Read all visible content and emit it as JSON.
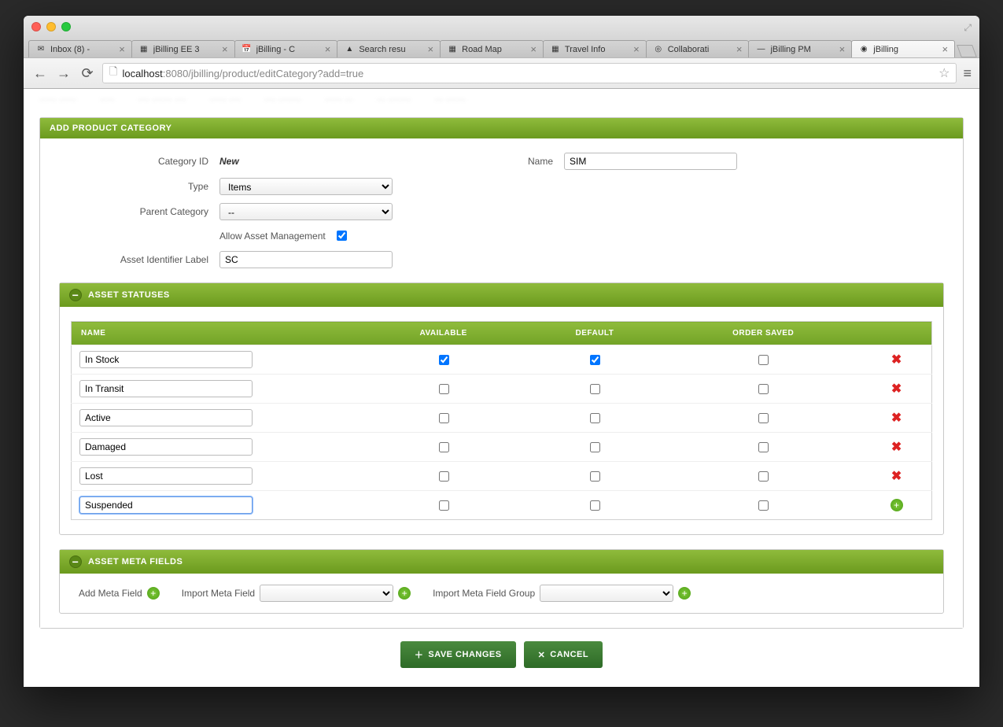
{
  "browser": {
    "url_host": "localhost",
    "url_path": ":8080/jbilling/product/editCategory?add=true",
    "tabs": [
      {
        "title": "Inbox (8) -",
        "icon": "✉"
      },
      {
        "title": "jBilling EE 3",
        "icon": "▦"
      },
      {
        "title": "jBilling - C",
        "icon": "📅"
      },
      {
        "title": "Search resu",
        "icon": "▲"
      },
      {
        "title": "Road Map",
        "icon": "▦"
      },
      {
        "title": "Travel Info",
        "icon": "▦"
      },
      {
        "title": "Collaborati",
        "icon": "◎"
      },
      {
        "title": "jBilling PM",
        "icon": "—"
      },
      {
        "title": "jBilling",
        "icon": "◉",
        "active": true
      }
    ]
  },
  "page": {
    "header": "ADD PRODUCT CATEGORY",
    "category_id_label": "Category ID",
    "category_id_value": "New",
    "name_label": "Name",
    "name_value": "SIM",
    "type_label": "Type",
    "type_value": "Items",
    "parent_label": "Parent Category",
    "parent_value": "--",
    "allow_asset_label": "Allow Asset Management",
    "allow_asset_checked": true,
    "asset_identifier_label": "Asset Identifier Label",
    "asset_identifier_value": "SC"
  },
  "statuses": {
    "header": "ASSET STATUSES",
    "columns": {
      "name": "NAME",
      "available": "AVAILABLE",
      "default": "DEFAULT",
      "order_saved": "ORDER SAVED"
    },
    "rows": [
      {
        "name": "In Stock",
        "available": true,
        "default": true,
        "order_saved": false,
        "action": "delete"
      },
      {
        "name": "In Transit",
        "available": false,
        "default": false,
        "order_saved": false,
        "action": "delete"
      },
      {
        "name": "Active",
        "available": false,
        "default": false,
        "order_saved": false,
        "action": "delete"
      },
      {
        "name": "Damaged",
        "available": false,
        "default": false,
        "order_saved": false,
        "action": "delete"
      },
      {
        "name": "Lost",
        "available": false,
        "default": false,
        "order_saved": false,
        "action": "delete"
      },
      {
        "name": "Suspended",
        "available": false,
        "default": false,
        "order_saved": false,
        "action": "add",
        "focused": true
      }
    ]
  },
  "meta": {
    "header": "ASSET META FIELDS",
    "add_label": "Add Meta Field",
    "import_label": "Import Meta Field",
    "import_group_label": "Import Meta Field Group"
  },
  "actions": {
    "save": "SAVE CHANGES",
    "cancel": "CANCEL"
  }
}
